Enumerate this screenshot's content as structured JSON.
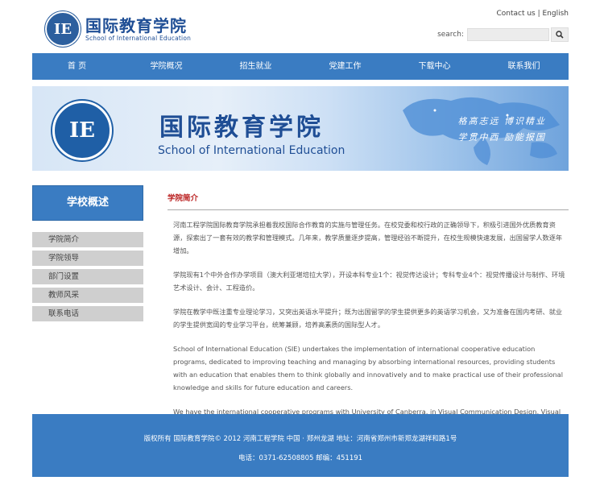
{
  "header": {
    "logo_cn": "国际教育学院",
    "logo_en": "School of International Education",
    "logo_seal_glyph": "IE",
    "top_links": [
      "Contact us",
      "English"
    ],
    "top_links_separator": " | ",
    "search_label": "search:",
    "search_value": "",
    "search_icon": "search-icon"
  },
  "nav": {
    "items": [
      "首 页",
      "学院概况",
      "招生就业",
      "党建工作",
      "下载中心",
      "联系我们"
    ]
  },
  "banner": {
    "title_cn": "国际教育学院",
    "title_en": "School of International Education",
    "slogan_line1": "格高志远  博识精业",
    "slogan_line2": "学贯中西  励能报国",
    "seal_glyph": "IE"
  },
  "sidebar": {
    "heading": "学校概述",
    "items": [
      "学院简介",
      "学院领导",
      "部门设置",
      "教师风采",
      "联系电话"
    ]
  },
  "main": {
    "title": "学院简介",
    "paragraphs": [
      "河南工程学院国际教育学院承担着我校国际合作教育的实施与管理任务。在校党委和校行政的正确领导下，积极引进国外优质教育资源，探索出了一套有效的教学和管理模式。几年来，教学质量逐步提高，管理经验不断提升，在校生规模快速发展，出国留学人数逐年增加。",
      "学院现有1个中外合作办学项目（澳大利亚堪培拉大学），开设本科专业1个：视觉传达设计；专科专业4个：视觉传播设计与制作、环境艺术设计、会计、工程造价。",
      "学院在教学中既注重专业理论学习，又突出英语水平提升；既为出国留学的学生提供更多的英语学习机会，又为准备在国内考研、就业的学生提供宽阔的专业学习平台，统筹兼顾，培养高素质的国际型人才。",
      "School of International Education (SIE) undertakes the implementation of international cooperative education programs, dedicated to improving teaching and managing by absorbing international resources, providing students with an education that enables them to think globally and innovatively and to make practical use of their professional knowledge and skills for future education and careers.",
      "We have the international cooperative programs with University of Canberra, in Visual Communication Design, Visual Communication Design and Production, Environmental Art Design, Accounting and Project Cost."
    ]
  },
  "footer": {
    "line1": "版权所有 国际教育学院© 2012 河南工程学院 中国 · 郑州龙湖 地址：河南省郑州市新郑龙湖祥和路1号",
    "line2": "电话：0371-62508805 邮编：451191"
  },
  "colors": {
    "primary_blue": "#3a7cc2",
    "title_red": "#b22222",
    "sidebar_item_bg": "#cfcfcf"
  }
}
